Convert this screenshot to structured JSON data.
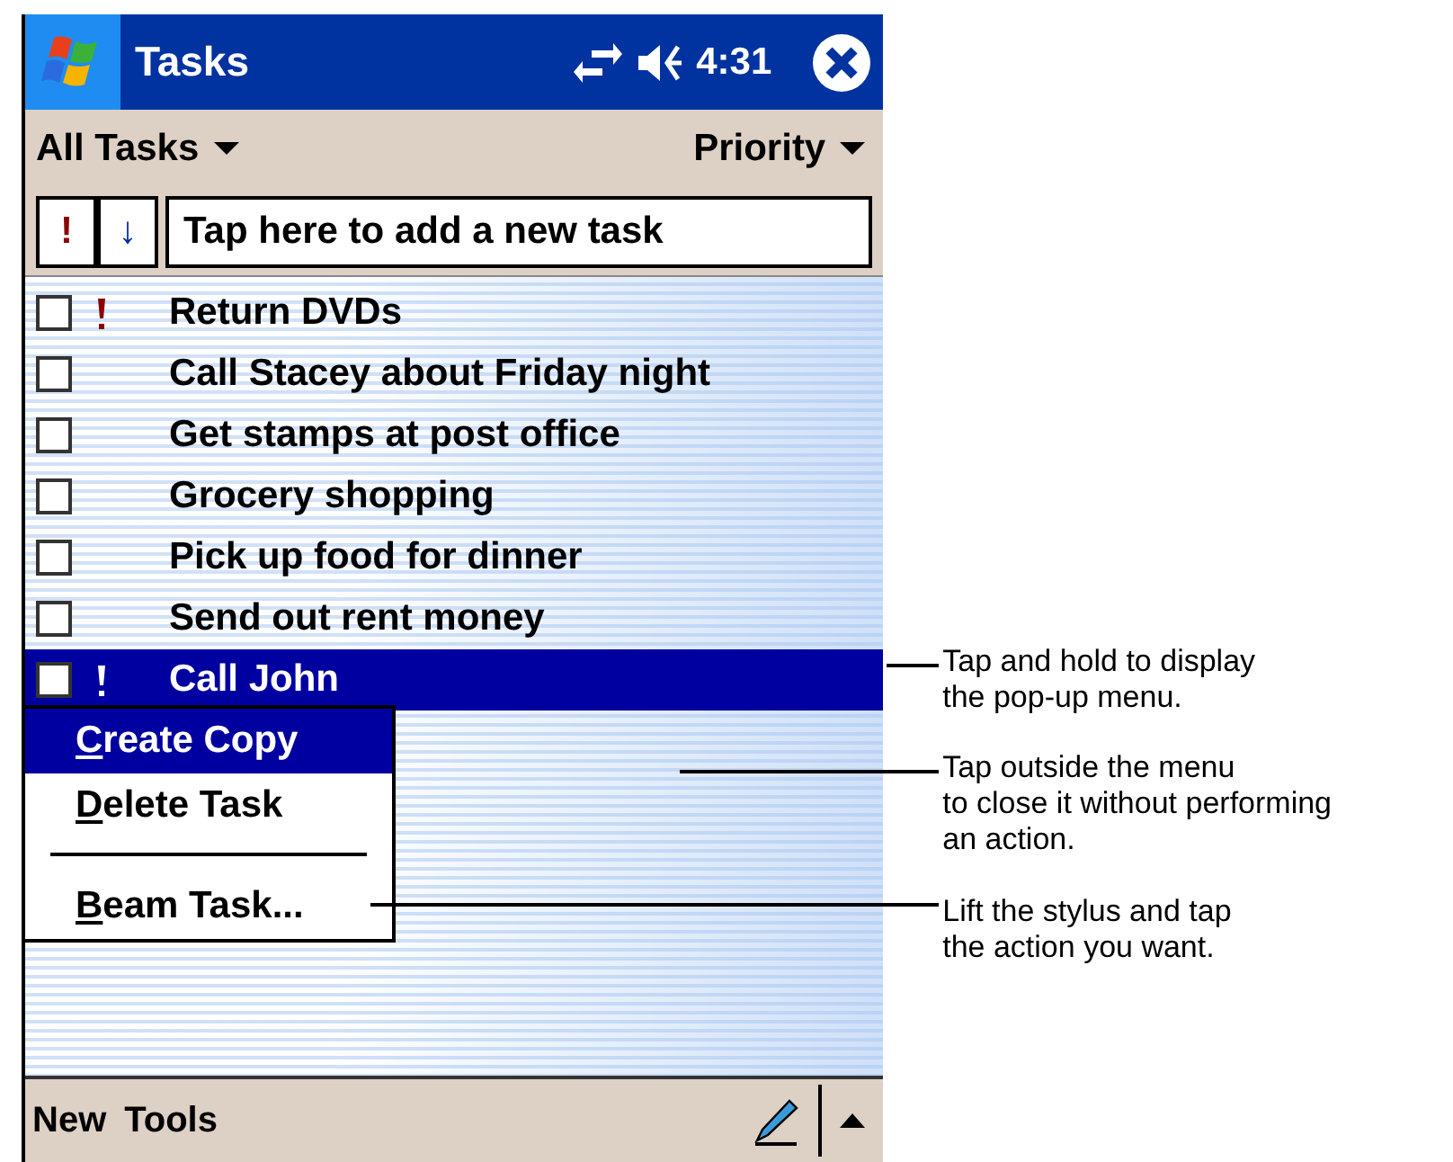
{
  "title_bar": {
    "title": "Tasks",
    "time": "4:31"
  },
  "header": {
    "filter": "All Tasks",
    "sort": "Priority"
  },
  "entry_bar": {
    "priority_button": "!",
    "sort_button": "↓",
    "placeholder": "Tap here to add a new task"
  },
  "tasks": [
    {
      "label": "Return DVDs",
      "checked": false,
      "high_priority": true,
      "selected": false
    },
    {
      "label": "Call Stacey about Friday night",
      "checked": false,
      "high_priority": false,
      "selected": false
    },
    {
      "label": "Get stamps at post office",
      "checked": false,
      "high_priority": false,
      "selected": false
    },
    {
      "label": "Grocery shopping",
      "checked": false,
      "high_priority": false,
      "selected": false
    },
    {
      "label": "Pick up food for dinner",
      "checked": false,
      "high_priority": false,
      "selected": false
    },
    {
      "label": "Send out rent money",
      "checked": false,
      "high_priority": false,
      "selected": false
    },
    {
      "label": "Call John",
      "checked": false,
      "high_priority": true,
      "selected": true
    }
  ],
  "popup_menu": [
    {
      "kind": "item",
      "label": "Create Copy",
      "selected": true
    },
    {
      "kind": "item",
      "label": "Delete Task",
      "selected": false
    },
    {
      "kind": "separator"
    },
    {
      "kind": "item",
      "label": "Beam Task...",
      "selected": false
    }
  ],
  "menu_bar": [
    "New",
    "Tools"
  ],
  "callouts": [
    {
      "lines": [
        "Tap and hold to display",
        "the pop-up menu."
      ]
    },
    {
      "lines": [
        "Tap outside the menu",
        "to close it without performing",
        "an action."
      ]
    },
    {
      "lines": [
        "Lift the stylus and tap",
        "the action you want."
      ]
    }
  ]
}
